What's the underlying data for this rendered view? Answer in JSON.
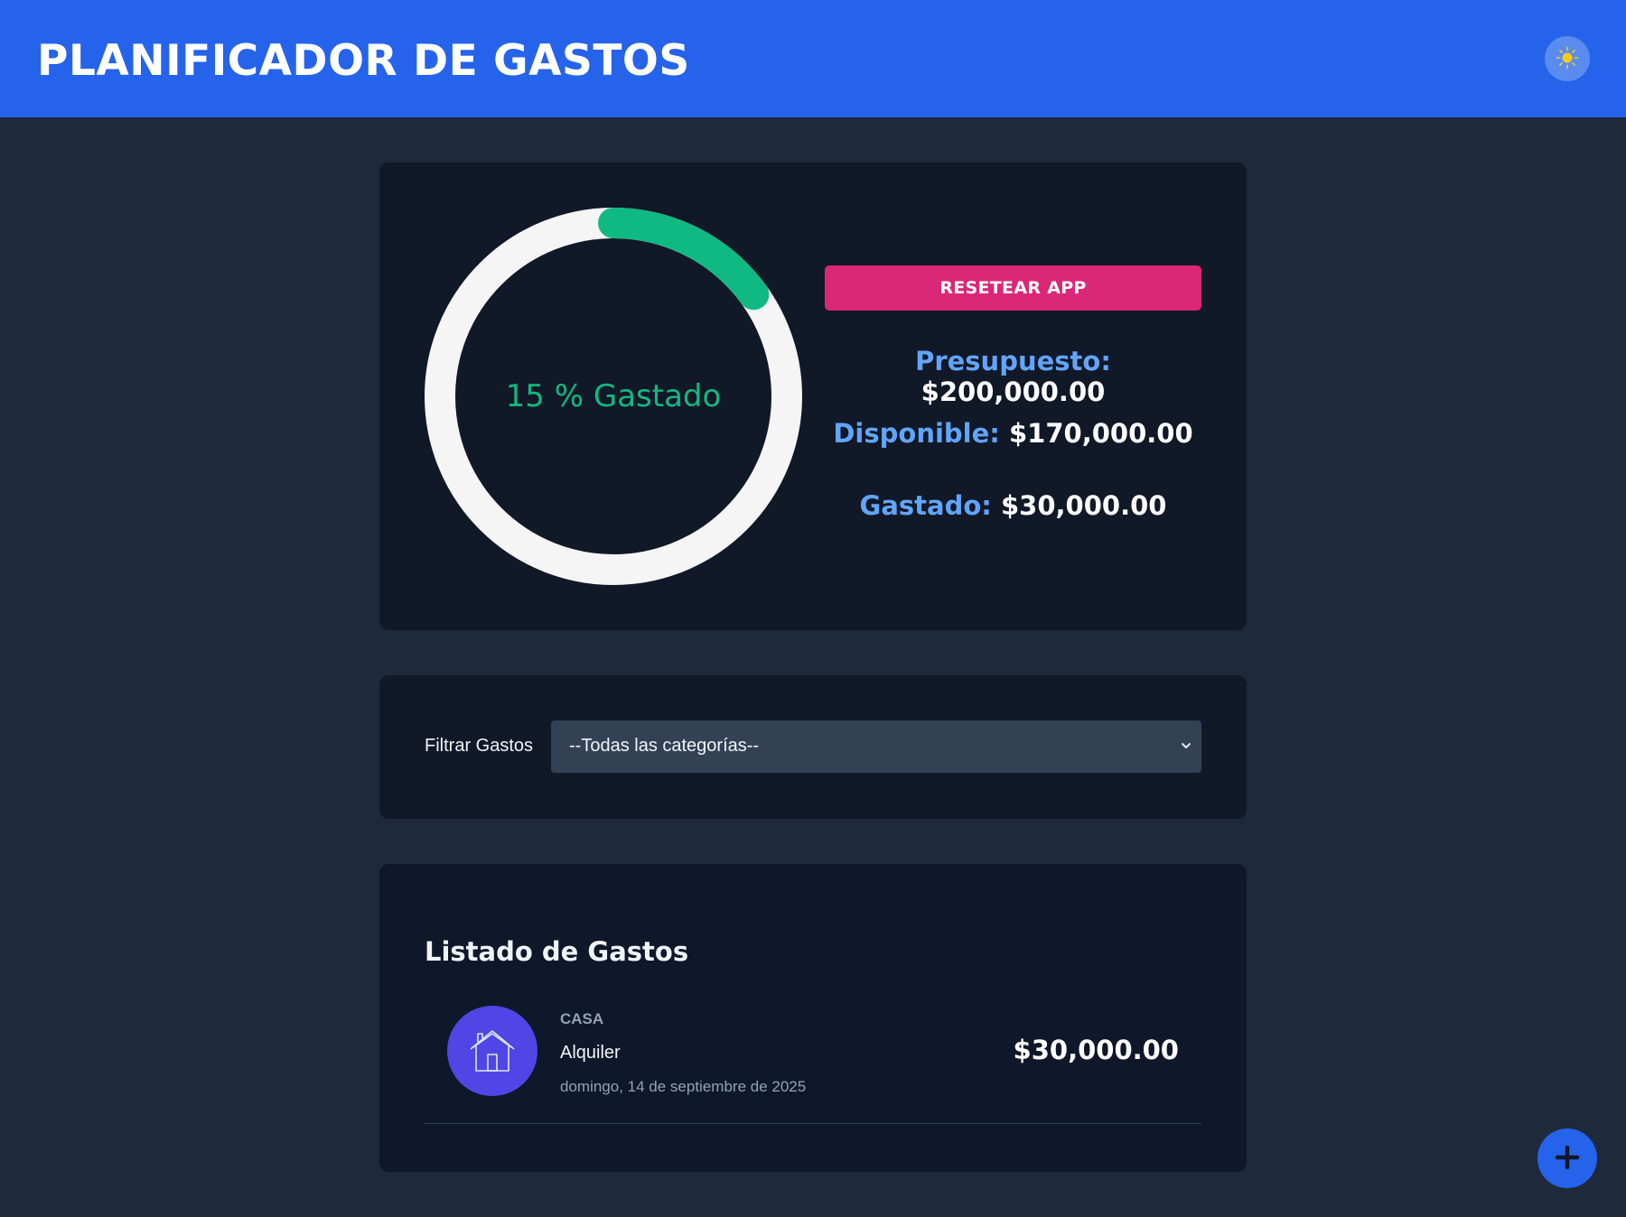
{
  "header": {
    "title": "PLANIFICADOR DE GASTOS",
    "theme_toggle_icon": "sun-icon"
  },
  "budget": {
    "percent_spent": 15,
    "progress_label": "15 % Gastado",
    "progress_color": "#10b981",
    "track_color": "#f5f5f5",
    "reset_label": "RESETEAR APP",
    "presupuesto_label": "Presupuesto:",
    "presupuesto_value": "$200,000.00",
    "disponible_label": "Disponible:",
    "disponible_value": "$170,000.00",
    "gastado_label": "Gastado:",
    "gastado_value": "$30,000.00"
  },
  "filter": {
    "label": "Filtrar Gastos",
    "selected": "--Todas las categorías--"
  },
  "list": {
    "title": "Listado de Gastos",
    "items": [
      {
        "category": "CASA",
        "name": "Alquiler",
        "date": "domingo, 14 de septiembre de 2025",
        "amount": "$30,000.00",
        "icon": "house-icon"
      }
    ]
  },
  "fab": {
    "icon": "plus-icon"
  },
  "colors": {
    "header": "#2563eb",
    "background": "#1e293b",
    "card": "#111827",
    "reset": "#db2777",
    "accent_label": "#60a5fa",
    "category_icon_bg": "#4f46e5"
  }
}
